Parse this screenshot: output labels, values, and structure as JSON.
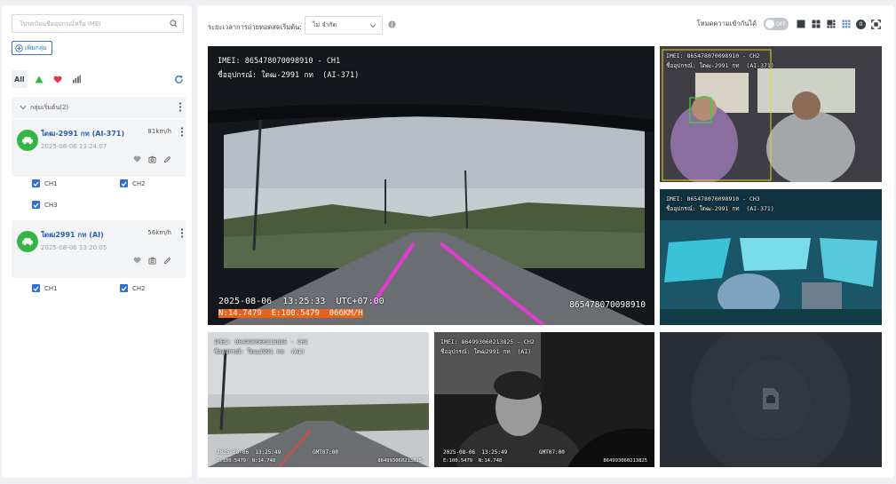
{
  "sidebar": {
    "search_placeholder": "โปรดป้อนชื่ออุปกรณ์หรือ IMEI",
    "add_group_label": "เพิ่มกลุ่ม",
    "filters": {
      "all_label": "All"
    },
    "group": {
      "label": "กลุ่มเริ่มต้น(2)"
    },
    "vehicles": [
      {
        "name": "ใดฒ-2991 กท  (AI-371)",
        "speed": "81km/h",
        "time": "2025-08-06 13:24:07",
        "channels": [
          "CH1",
          "CH2",
          "CH3"
        ]
      },
      {
        "name": "ใดฒ2991 กท  (AI)",
        "speed": "56km/h",
        "time": "2025-08-06 13:20:05",
        "channels": [
          "CH1",
          "CH2"
        ]
      }
    ]
  },
  "toolbar": {
    "duration_label": "ระยะเวลาการถ่ายทอดสดเริ่มต้น:",
    "duration_value": "ไม่ จำกัด",
    "fullscreen_label": "โหมดความเข้ากันได้",
    "toggle_text": "OFF",
    "badge_count": "0"
  },
  "tiles": {
    "main": {
      "title": "IMEI: 865478070098910 - CH1",
      "subtitle": "ชื่ออุปกรณ์: ใดฒ-2991 กท  (AI-371)",
      "timestamp": "2025-08-06  13:25:33  UTC+07:00",
      "gps": "N:14.7479  E:100.5479  066KM/H",
      "imei_stamp": "865478070098910"
    },
    "ch2": {
      "title": "IMEI: 865478070098910 - CH2",
      "subtitle": "ชื่ออุปกรณ์: ใดฒ-2991 กท  (AI-371)"
    },
    "ch3": {
      "title": "IMEI: 865478070098910 - CH3",
      "subtitle": "ชื่ออุปกรณ์: ใดฒ-2991 กท  (AI-371)"
    },
    "b1": {
      "title": "IMEI: 864993060213825 - CH1",
      "subtitle": "ชื่ออุปกรณ์: ใดฒ2991 กท  (AI)",
      "timestamp": "2025-08-06  13:25:49",
      "tz": "GMT07:00",
      "stamp_left": "E:100.5479  N:14.748",
      "stamp_right": "864993060213825"
    },
    "b2": {
      "title": "IMEI: 864993060213825 - CH2",
      "subtitle": "ชื่ออุปกรณ์: ใดฒ2991 กท  (AI)",
      "timestamp": "2025-08-06  13:25:49",
      "tz": "GMT07:00",
      "stamp_left": "E:100.5479  N:14.748",
      "stamp_right": "864993060213825"
    }
  },
  "colors": {
    "accent": "#2f6fd6",
    "vehicle_icon": "#34b646",
    "gps_bg": "#e3641a",
    "lane_line": "#e03ccf"
  },
  "icons": {
    "search": "search-icon",
    "add": "plus-circle-icon",
    "online": "triangle-up-icon",
    "favorite": "heart-icon",
    "signal": "signal-bars-icon",
    "refresh": "refresh-icon",
    "vehicle": "car-icon",
    "more": "more-vertical-icon",
    "snapshot": "camera-icon",
    "edit": "edit-icon",
    "info": "info-icon",
    "video_file": "video-file-icon"
  }
}
